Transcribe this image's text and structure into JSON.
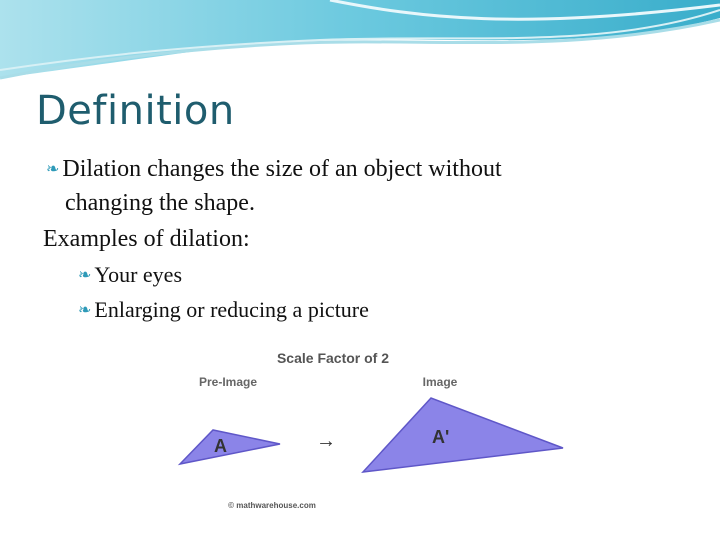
{
  "slide": {
    "title": "Definition",
    "definition_line1": "Dilation changes the size of an object without",
    "definition_line2": "changing the shape.",
    "examples_heading": "Examples of dilation:",
    "examples": [
      "Your eyes",
      "Enlarging or reducing a picture"
    ]
  },
  "figure": {
    "title": "Scale Factor of 2",
    "pre_image_label": "Pre-Image",
    "image_label": "Image",
    "pre_image_vertex": "A",
    "image_vertex": "A'",
    "arrow": "→",
    "credit": "© mathwarehouse.com",
    "triangle_fill": "#8b84e8",
    "triangle_stroke": "#5f57c8"
  },
  "colors": {
    "title": "#1f5d6e",
    "bullet": "#2e9ab8",
    "header_wave": "#5cc2da"
  }
}
